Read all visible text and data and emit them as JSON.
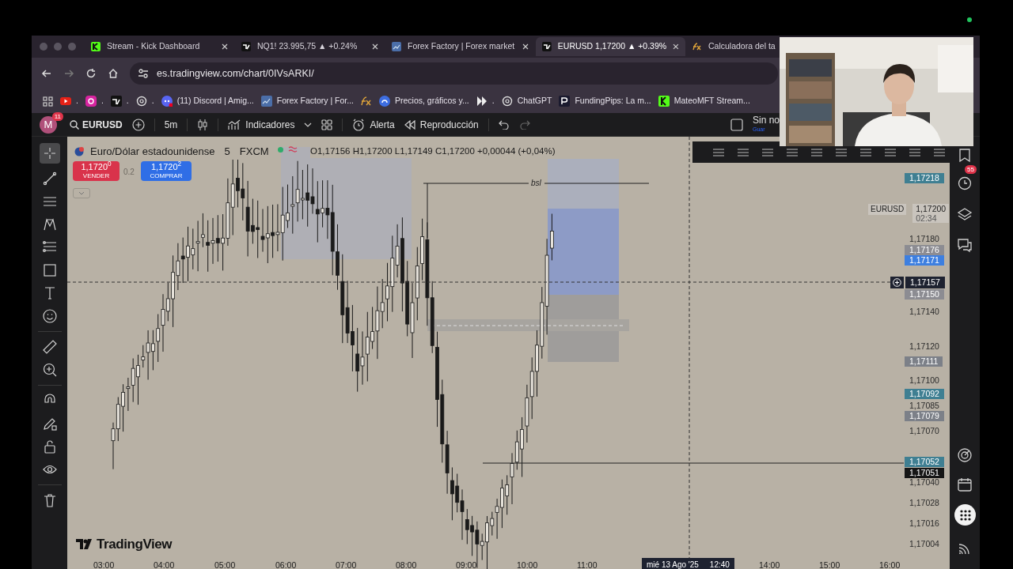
{
  "browser": {
    "tabs": [
      {
        "title": "Stream - Kick Dashboard",
        "selected": false
      },
      {
        "title": "NQ1! 23.995,75 ▲ +0.24%",
        "selected": false
      },
      {
        "title": "Forex Factory | Forex market",
        "selected": false
      },
      {
        "title": "EURUSD 1,17200 ▲ +0.39%",
        "selected": true
      },
      {
        "title": "Calculadora del ta",
        "selected": false
      }
    ],
    "url": "es.tradingview.com/chart/0IVsARKI/",
    "bookmarks": [
      {
        "kind": "labeled",
        "label": "."
      },
      {
        "kind": "labeled",
        "label": "."
      },
      {
        "kind": "labeled",
        "label": "."
      },
      {
        "kind": "labeled",
        "label": "."
      },
      {
        "kind": "labeled",
        "label": "(11) Discord | Amig..."
      },
      {
        "kind": "labeled",
        "label": "Forex Factory | For..."
      },
      {
        "kind": "icon"
      },
      {
        "kind": "labeled",
        "label": "Precios, gráficos y..."
      },
      {
        "kind": "labeled",
        "label": "."
      },
      {
        "kind": "labeled",
        "label": "ChatGPT"
      },
      {
        "kind": "labeled",
        "label": "FundingPips: La m..."
      },
      {
        "kind": "labeled",
        "label": "MateoMFT Stream..."
      }
    ]
  },
  "toolbar": {
    "avatar": "M",
    "avatar_badge": "11",
    "symbol": "EURUSD",
    "interval": "5m",
    "indicators": "Indicadores",
    "alert": "Alerta",
    "replay": "Reproducción",
    "save": "Sin no",
    "save_hint": "Guar"
  },
  "legend": {
    "title": "Euro/Dólar estadounidense",
    "interval": "5",
    "exchange": "FXCM",
    "ohlc": "O1,17156 H1,17200 L1,17149 C1,17200 +0,00044 (+0,04%)",
    "sell": {
      "price": "1,1720$^{0}$",
      "label": "VENDER"
    },
    "spread": "0.2",
    "buy": {
      "price": "1,1720$^{2}$",
      "label": "COMPRAR"
    }
  },
  "chart": {
    "bsl_label": "bsl",
    "symbol_tag": {
      "symbol": "EURUSD",
      "price": "1,17200",
      "countdown": "02:34"
    },
    "price_labels": [
      {
        "text": "1,17218",
        "kind": "tag",
        "color": "#3f7f92"
      },
      {
        "text": "1,17180",
        "kind": "plain"
      },
      {
        "text": "1,17176",
        "kind": "tag",
        "color": "#8c8c92"
      },
      {
        "text": "1,17171",
        "kind": "tag",
        "color": "#3d7fe0"
      },
      {
        "text": "1,17157",
        "kind": "crosshair"
      },
      {
        "text": "1,17150",
        "kind": "tag",
        "color": "#8c8c92"
      },
      {
        "text": "1,17140",
        "kind": "plain"
      },
      {
        "text": "1,17120",
        "kind": "plain"
      },
      {
        "text": "1,17111",
        "kind": "tag",
        "color": "#7c8088"
      },
      {
        "text": "1,17100",
        "kind": "plain"
      },
      {
        "text": "1,17092",
        "kind": "tag",
        "color": "#3f7f92"
      },
      {
        "text": "1,17085",
        "kind": "plain"
      },
      {
        "text": "1,17079",
        "kind": "tag",
        "color": "#7c8088"
      },
      {
        "text": "1,17070",
        "kind": "plain"
      },
      {
        "text": "1,17052",
        "kind": "tag",
        "color": "#3f7f92"
      },
      {
        "text": "1,17051",
        "kind": "tag",
        "color": "#161616"
      },
      {
        "text": "1,17040",
        "kind": "plain"
      },
      {
        "text": "1,17028",
        "kind": "plain"
      },
      {
        "text": "1,17016",
        "kind": "plain"
      },
      {
        "text": "1,17004",
        "kind": "plain"
      }
    ],
    "time_ticks": [
      "03:00",
      "04:00",
      "05:00",
      "06:00",
      "07:00",
      "08:00",
      "09:00",
      "10:00",
      "11:00",
      "14:00",
      "15:00",
      "16:00"
    ],
    "crosshair_date": "mié 13 Ago '25",
    "crosshair_time": "12:40",
    "logo": "TradingView"
  },
  "sidebar": {
    "alerts_badge": "55"
  }
}
